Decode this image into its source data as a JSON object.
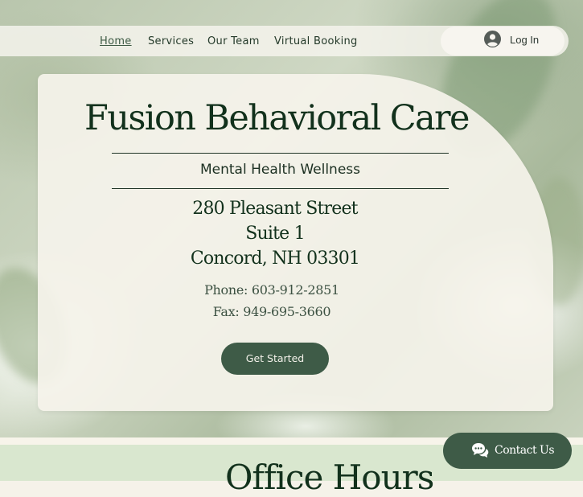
{
  "nav": {
    "items": [
      {
        "label": "Home",
        "active": true
      },
      {
        "label": "Services",
        "active": false
      },
      {
        "label": "Our Team",
        "active": false
      },
      {
        "label": "Virtual Booking",
        "active": false
      }
    ],
    "login_label": "Log In",
    "login_icon": "user-avatar-icon"
  },
  "hero": {
    "brand": "Fusion Behavioral Care",
    "tagline": "Mental Health Wellness",
    "address": [
      "280 Pleasant Street",
      "Suite 1",
      "Concord, NH 03301"
    ],
    "phone": "Phone: 603-912-2851",
    "fax": "Fax: 949-695-3660",
    "cta_label": "Get Started"
  },
  "section": {
    "title": "Office Hours"
  },
  "chat": {
    "label": "Contact Us",
    "icon": "chat-bubble-icon"
  },
  "colors": {
    "accent": "#3e5b47",
    "brand_text": "#12311c",
    "lower_section_bg": "#d9e7cf"
  }
}
